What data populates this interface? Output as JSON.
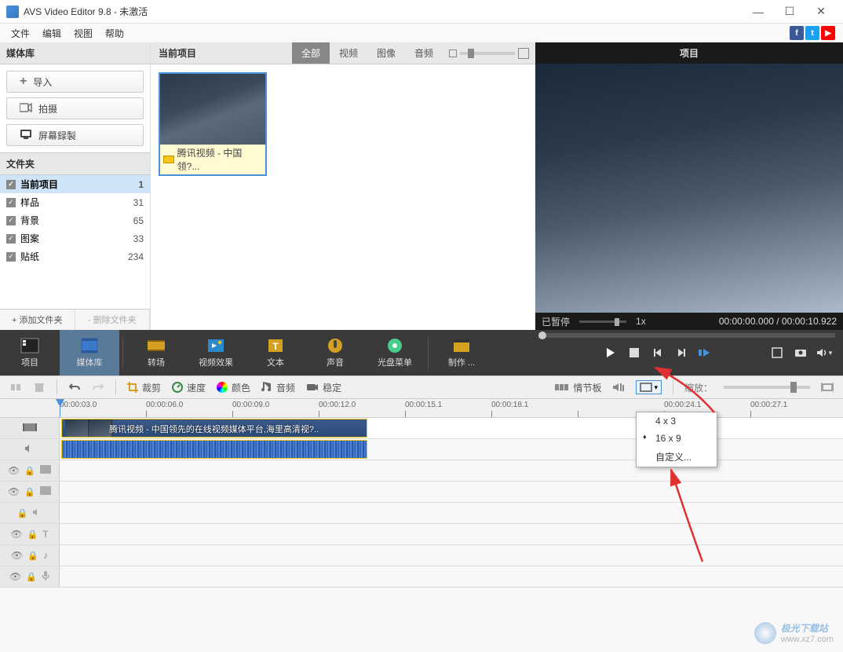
{
  "window": {
    "title": "AVS Video Editor 9.8 - 未激活",
    "buttons": {
      "min": "—",
      "max": "☐",
      "close": "✕"
    }
  },
  "menu": {
    "file": "文件",
    "edit": "编辑",
    "view": "视图",
    "help": "帮助"
  },
  "social": {
    "fb": "f",
    "tw": "t",
    "yt": "▶"
  },
  "left": {
    "media_lib": "媒体库",
    "import": "导入",
    "capture": "拍摄",
    "screenrec": "屏幕録製",
    "folders": "文件夹",
    "items": [
      {
        "name": "当前项目",
        "count": "1",
        "selected": true
      },
      {
        "name": "样品",
        "count": "31"
      },
      {
        "name": "背景",
        "count": "65"
      },
      {
        "name": "图案",
        "count": "33"
      },
      {
        "name": "贴纸",
        "count": "234"
      }
    ],
    "add_folder": "+ 添加文件夹",
    "del_folder": "- 删除文件夹"
  },
  "center": {
    "title": "当前项目",
    "filters": {
      "all": "全部",
      "video": "视频",
      "image": "图像",
      "audio": "音频"
    },
    "thumb_label": "腾讯视频 - 中国领?..."
  },
  "preview": {
    "title": "项目",
    "status": "已暂停",
    "speed": "1x",
    "tc_cur": "00:00:00.000",
    "tc_sep": "/",
    "tc_dur": "00:00:10.922"
  },
  "tooltabs": {
    "project": "项目",
    "media": "媒体库",
    "transition": "转场",
    "vfx": "视频效果",
    "text": "文本",
    "audio": "声音",
    "disc": "光盘菜单",
    "produce": "制作 ..."
  },
  "lighttb": {
    "crop": "裁剪",
    "speed": "速度",
    "color": "颜色",
    "audio": "音频",
    "stable": "稳定",
    "storyboard": "情节板",
    "zoom_label": "缩放："
  },
  "aspect_menu": {
    "a43": "4 x 3",
    "a169": "16 x 9",
    "custom": "自定义..."
  },
  "ruler": [
    "00:00:03.0",
    "00:00:06.0",
    "00:00:09.0",
    "00:00:12.0",
    "00:00:15.1",
    "00:00:18.1",
    "",
    "00:00:24.1",
    "00:00:27.1"
  ],
  "clip": {
    "title": "腾讯视频 - 中国领先的在线视频媒体平台,海里高清视?.."
  },
  "watermark": {
    "site": "极光下载站",
    "url": "www.xz7.com"
  }
}
